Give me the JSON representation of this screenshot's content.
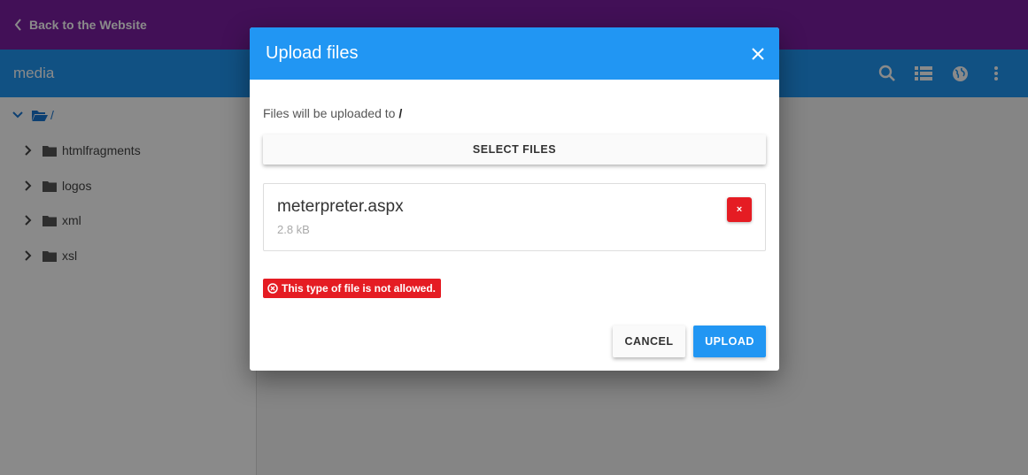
{
  "topbar": {
    "back_label": "Back to the Website",
    "color": "#7b1fa2"
  },
  "appbar": {
    "title": "media",
    "color": "#2196f3",
    "actions": [
      "search-icon",
      "list-view-icon",
      "globe-icon",
      "more-vert-icon"
    ]
  },
  "tree": {
    "root": {
      "label": "/",
      "icon": "folder-open-icon"
    },
    "items": [
      {
        "label": "htmlfragments",
        "icon": "folder-icon"
      },
      {
        "label": "logos",
        "icon": "folder-icon"
      },
      {
        "label": "xml",
        "icon": "folder-icon"
      },
      {
        "label": "xsl",
        "icon": "folder-icon"
      }
    ]
  },
  "dialog": {
    "title": "Upload files",
    "destination_prefix": "Files will be uploaded to",
    "destination_path": "/",
    "select_files_label": "SELECT FILES",
    "file": {
      "name": "meterpreter.aspx",
      "size": "2.8 kB",
      "remove_label": "×"
    },
    "error": "This type of file is not allowed.",
    "cancel_label": "CANCEL",
    "upload_label": "UPLOAD",
    "colors": {
      "error": "#e51c23",
      "primary": "#2196f3"
    }
  }
}
